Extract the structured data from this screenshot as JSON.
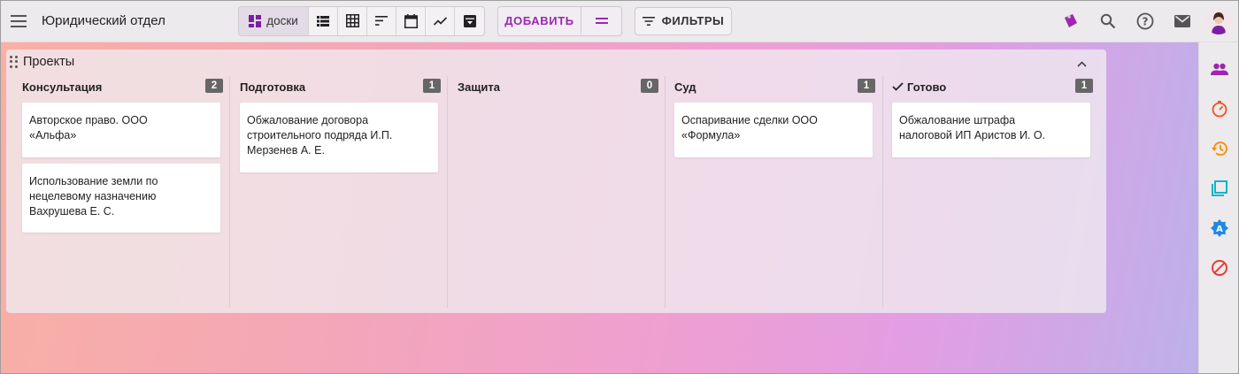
{
  "header": {
    "title": "Юридический отдел",
    "views_active_label": "доски",
    "add_label": "ДОБАВИТЬ",
    "filters_label": "ФИЛЬТРЫ"
  },
  "board": {
    "title": "Проекты",
    "columns": [
      {
        "title": "Консультация",
        "count": "2",
        "cards": [
          "Авторское право. ООО\n«Альфа»",
          "Использование земли по\nнецелевому назначению\nВахрушева Е. С."
        ]
      },
      {
        "title": "Подготовка",
        "count": "1",
        "cards": [
          "Обжалование договора\nстроительного подряда И.П.\nМерзенев А. Е."
        ]
      },
      {
        "title": "Защита",
        "count": "0",
        "cards": []
      },
      {
        "title": "Суд",
        "count": "1",
        "cards": [
          "Оспаривание сделки ООО\n«Формула»"
        ]
      },
      {
        "title": "Готово",
        "count": "1",
        "cards": [
          "Обжалование штрафа\nналоговой ИП Аристов И. О."
        ]
      }
    ]
  },
  "colors": {
    "accent": "#9c27b0",
    "badge": "#666666",
    "sidebar_people": "#9c27b0",
    "sidebar_timer": "#f4511e",
    "sidebar_history": "#fb8c00",
    "sidebar_layers": "#00acc1",
    "sidebar_badge": "#1e88e5",
    "sidebar_block": "#e53935"
  },
  "icons": {
    "top": [
      "menu-icon",
      "dashboard-icon",
      "list-icon",
      "grid-icon",
      "sort-icon",
      "calendar-icon",
      "chart-icon",
      "archive-icon",
      "filter-icon",
      "tag-icon",
      "search-icon",
      "help-icon",
      "mail-icon"
    ],
    "sidebar": [
      "people-icon",
      "timer-icon",
      "history-icon",
      "layers-icon",
      "badge-a-icon",
      "block-icon"
    ]
  }
}
